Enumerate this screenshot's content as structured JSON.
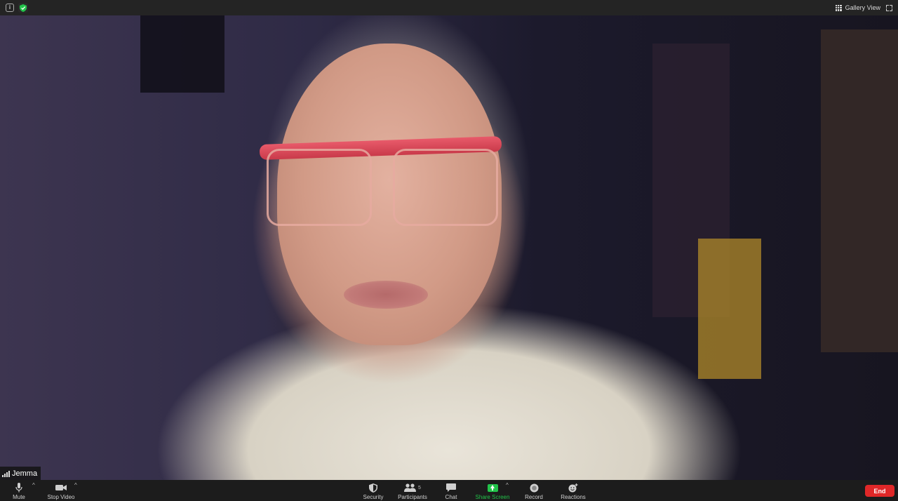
{
  "topbar": {
    "info_icon_glyph": "i",
    "security_status_icon": "shield-check-icon",
    "gallery_view_label": "Gallery View",
    "accent_green": "#22c34a"
  },
  "participant": {
    "name": "Jemma"
  },
  "toolbar": {
    "mute_label": "Mute",
    "stop_video_label": "Stop Video",
    "security_label": "Security",
    "participants_label": "Participants",
    "participants_count": "5",
    "chat_label": "Chat",
    "share_screen_label": "Share Screen",
    "record_label": "Record",
    "reactions_label": "Reactions",
    "end_label": "End",
    "end_color": "#e02828"
  }
}
